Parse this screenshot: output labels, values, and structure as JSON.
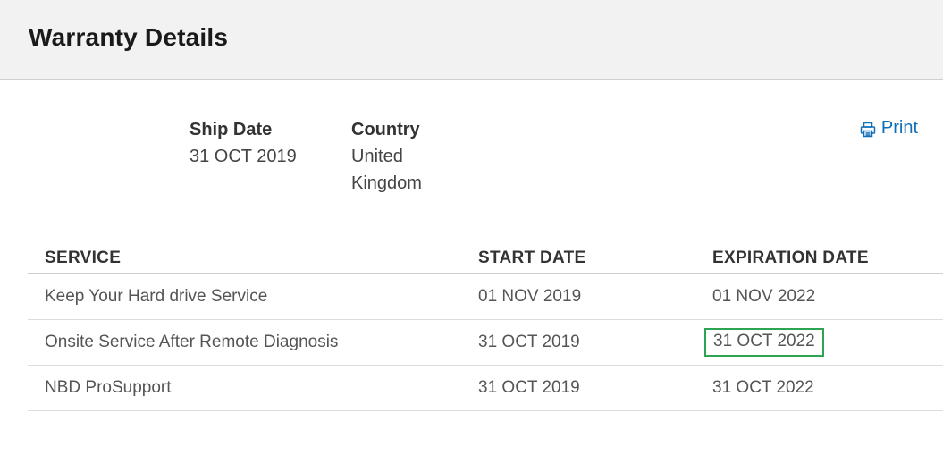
{
  "header": {
    "title": "Warranty Details"
  },
  "info": {
    "ship_date_label": "Ship Date",
    "ship_date_value": "31 OCT 2019",
    "country_label": "Country",
    "country_value": "United Kingdom"
  },
  "print": {
    "label": "Print",
    "icon": "printer-icon",
    "color": "#0e6eb8"
  },
  "table": {
    "headers": [
      "SERVICE",
      "START DATE",
      "EXPIRATION DATE"
    ],
    "rows": [
      [
        "Keep Your Hard drive Service",
        "01 NOV 2019",
        "01 NOV 2022"
      ],
      [
        "Onsite Service After Remote Diagnosis",
        "31 OCT 2019",
        "31 OCT 2022"
      ],
      [
        "NBD ProSupport",
        "31 OCT 2019",
        "31 OCT 2022"
      ]
    ],
    "highlight_color": "#2ea352"
  }
}
